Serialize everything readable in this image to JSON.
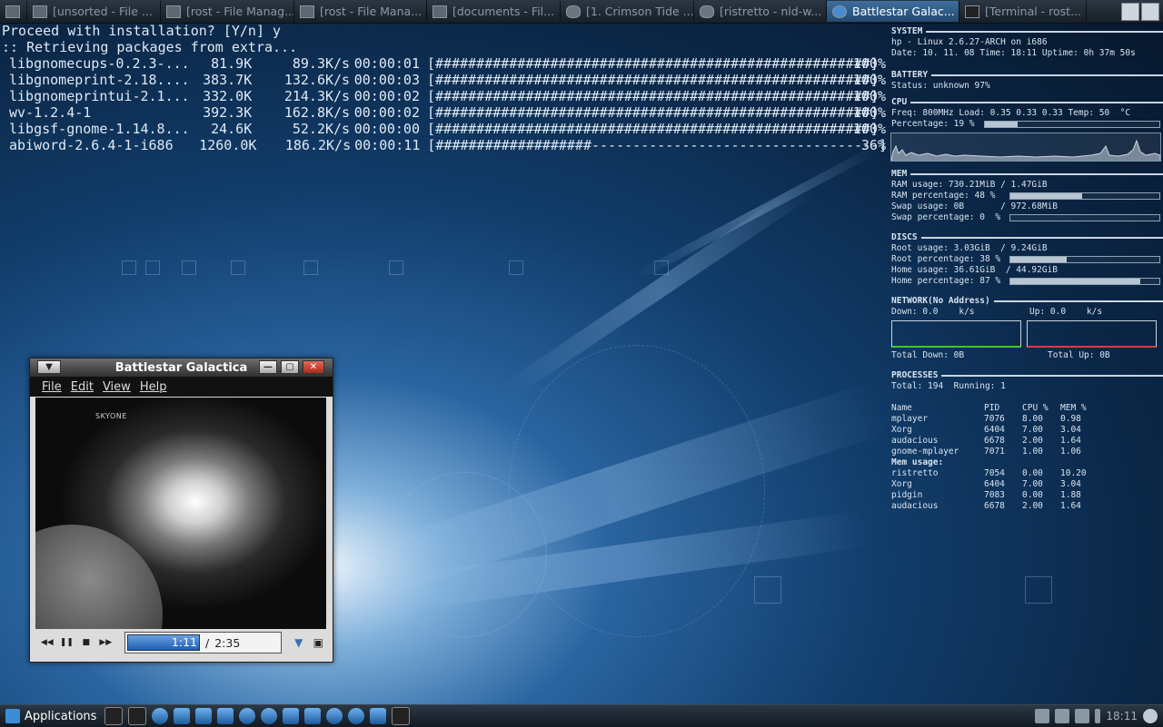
{
  "taskbar": {
    "tasks": [
      {
        "label": "[unsorted - File ...",
        "icon": "folder-icon",
        "active": false
      },
      {
        "label": "[rost - File Manag...",
        "icon": "folder-icon",
        "active": false
      },
      {
        "label": "[rost - File Mana...",
        "icon": "folder-icon",
        "active": false
      },
      {
        "label": "[documents - Fil...",
        "icon": "folder-icon",
        "active": false
      },
      {
        "label": "[1. Crimson Tide ...",
        "icon": "audio-player-icon",
        "active": false
      },
      {
        "label": "[ristretto - nld-w...",
        "icon": "image-viewer-icon",
        "active": false
      },
      {
        "label": "Battlestar Galac...",
        "icon": "media-player-icon",
        "active": true
      },
      {
        "label": "[Terminal - rost...",
        "icon": "terminal-icon",
        "active": false
      }
    ]
  },
  "terminal": {
    "prompt": "Proceed with installation? [Y/n] y",
    "retrieving": ":: Retrieving packages from extra...",
    "packages": [
      {
        "name": "libgnomecups-0.2.3-...",
        "size": "81.9K",
        "rate": "89.3K/s",
        "time": "00:00:01",
        "bar": "[#####################################################]",
        "pct": "100%"
      },
      {
        "name": "libgnomeprint-2.18....",
        "size": "383.7K",
        "rate": "132.6K/s",
        "time": "00:00:03",
        "bar": "[#####################################################]",
        "pct": "100%"
      },
      {
        "name": "libgnomeprintui-2.1...",
        "size": "332.0K",
        "rate": "214.3K/s",
        "time": "00:00:02",
        "bar": "[#####################################################]",
        "pct": "100%"
      },
      {
        "name": "wv-1.2.4-1",
        "size": "392.3K",
        "rate": "162.8K/s",
        "time": "00:00:02",
        "bar": "[#####################################################]",
        "pct": "100%"
      },
      {
        "name": "libgsf-gnome-1.14.8...",
        "size": "24.6K",
        "rate": "52.2K/s",
        "time": "00:00:00",
        "bar": "[#####################################################]",
        "pct": "100%"
      },
      {
        "name": "abiword-2.6.4-1-i686",
        "size": "1260.0K",
        "rate": "186.2K/s",
        "time": "00:00:11",
        "bar": "[###################-----------------------------------]",
        "pct": "36%"
      }
    ]
  },
  "conky": {
    "system": {
      "title": "SYSTEM",
      "line1": "hp - Linux 2.6.27-ARCH on i686",
      "line2": "Date: 10. 11. 08 Time: 18:11 Uptime: 0h 37m 50s"
    },
    "battery": {
      "title": "BATTERY",
      "status": "Status: unknown 97%"
    },
    "cpu": {
      "title": "CPU",
      "freq": "Freq: 800MHz Load: 0.35 0.33 0.33 Temp: 50  °C",
      "percentage": "Percentage: 19 %",
      "pct_value": 0.19
    },
    "mem": {
      "title": "MEM",
      "ram_usage": "RAM usage: 730.21MiB / 1.47GiB",
      "ram_pct": "RAM percentage: 48 %",
      "ram_value": 0.48,
      "swap_usage": "Swap usage: 0B       / 972.68MiB",
      "swap_pct": "Swap percentage: 0  %",
      "swap_value": 0.0
    },
    "discs": {
      "title": "DISCS",
      "root_usage": "Root usage: 3.03GiB  / 9.24GiB",
      "root_pct": "Root percentage: 38 %",
      "root_value": 0.38,
      "home_usage": "Home usage: 36.61GiB  / 44.92GiB",
      "home_pct": "Home percentage: 87 %",
      "home_value": 0.87
    },
    "network": {
      "title": "NETWORK(No Address)",
      "down": "Down: 0.0    k/s",
      "up": "Up: 0.0    k/s",
      "total_down": "Total Down: 0B",
      "total_up": "Total Up: 0B"
    },
    "processes": {
      "title": "PROCESSES",
      "summary": "Total: 194  Running: 1",
      "headers": [
        "Name",
        "PID",
        "CPU %",
        "MEM %"
      ],
      "cpu_rows": [
        [
          "mplayer",
          "7076",
          "8.00",
          "0.98"
        ],
        [
          "Xorg",
          "6404",
          "7.00",
          "3.04"
        ],
        [
          "audacious",
          "6678",
          "2.00",
          "1.64"
        ],
        [
          "gnome-mplayer",
          "7071",
          "1.00",
          "1.06"
        ]
      ],
      "mem_label": "Mem usage:",
      "mem_rows": [
        [
          "ristretto",
          "7054",
          "0.00",
          "10.20"
        ],
        [
          "Xorg",
          "6404",
          "7.00",
          "3.04"
        ],
        [
          "pidgin",
          "7083",
          "0.00",
          "1.88"
        ],
        [
          "audacious",
          "6678",
          "2.00",
          "1.64"
        ]
      ]
    }
  },
  "player": {
    "title": "Battlestar Galactica",
    "menu": [
      "File",
      "Edit",
      "View",
      "Help"
    ],
    "video_logo": "SKYONE",
    "current_time": "1:11",
    "separator": "/",
    "total_time": "2:35",
    "progress": 0.46
  },
  "panel": {
    "applications_label": "Applications",
    "clock": "18:11"
  }
}
